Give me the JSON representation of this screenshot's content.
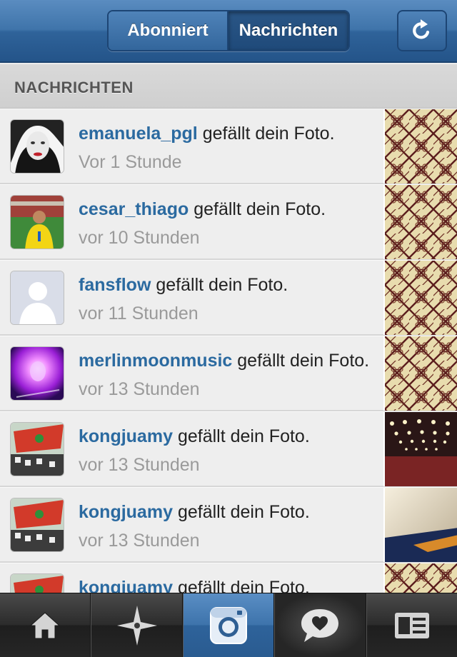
{
  "header": {
    "segments": [
      {
        "label": "Abonniert",
        "active": false
      },
      {
        "label": "Nachrichten",
        "active": true
      }
    ],
    "refresh_icon": "refresh-icon"
  },
  "section": {
    "title": "NACHRICHTEN"
  },
  "notifications": [
    {
      "username": "emanuela_pgl",
      "action": "gefällt dein Foto.",
      "time": "Vor 1 Stunde",
      "avatar": "avatar-bw-portrait",
      "thumbnail": "photo-pattern"
    },
    {
      "username": "cesar_thiago",
      "action": "gefällt dein Foto.",
      "time": "vor 10 Stunden",
      "avatar": "avatar-stadium",
      "thumbnail": "photo-pattern"
    },
    {
      "username": "fansflow",
      "action": "gefällt dein Foto.",
      "time": "vor 11 Stunden",
      "avatar": "avatar-default",
      "thumbnail": "photo-pattern"
    },
    {
      "username": "merlinmoonmusic",
      "action": "gefällt dein Foto.",
      "time": "vor 13 Stunden",
      "avatar": "avatar-purple",
      "thumbnail": "photo-pattern"
    },
    {
      "username": "kongjuamy",
      "action": "gefällt dein Foto.",
      "time": "vor 13 Stunden",
      "avatar": "avatar-flag",
      "thumbnail": "photo-lights"
    },
    {
      "username": "kongjuamy",
      "action": "gefällt dein Foto.",
      "time": "vor 13 Stunden",
      "avatar": "avatar-flag",
      "thumbnail": "photo-ceiling"
    },
    {
      "username": "kongjuamy",
      "action": "gefällt dein Foto.",
      "time": "",
      "avatar": "avatar-flag",
      "thumbnail": "photo-pattern"
    }
  ],
  "tabbar": {
    "tabs": [
      {
        "icon": "home-icon",
        "active": false
      },
      {
        "icon": "explore-star-icon",
        "active": false
      },
      {
        "icon": "camera-icon",
        "active": true
      },
      {
        "icon": "news-heart-bubble-icon",
        "active": true
      },
      {
        "icon": "profile-card-icon",
        "active": false
      }
    ]
  },
  "colors": {
    "nav_blue": "#3f74aa",
    "username_blue": "#2b6aa0",
    "time_gray": "#9a9a9a"
  }
}
